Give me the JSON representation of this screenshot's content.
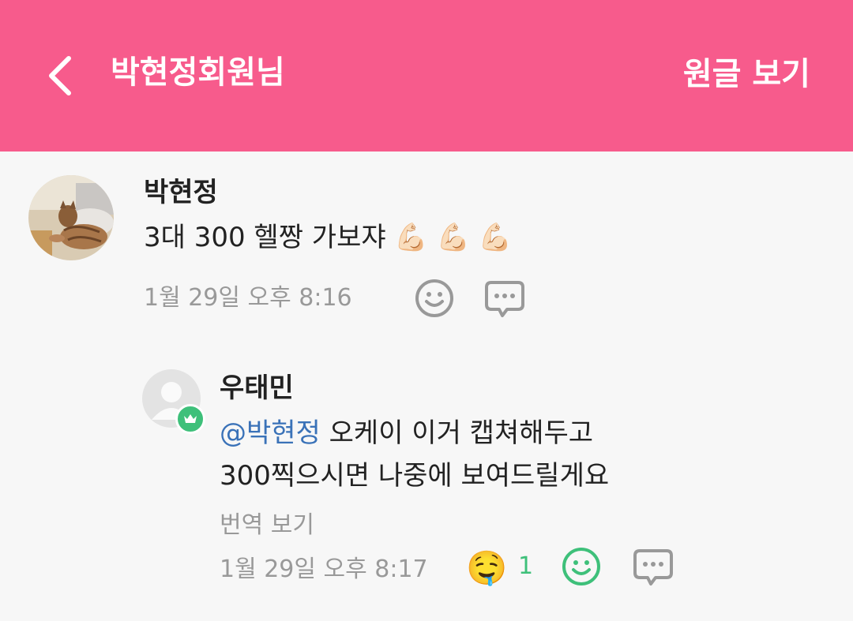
{
  "header": {
    "title": "박현정회원님",
    "action_label": "원글 보기",
    "background_color": "#f75b8c"
  },
  "comment": {
    "author": "박현정",
    "text": "3대 300 헬짱 가보쟈 💪🏻 💪🏻 💪🏻",
    "timestamp": "1월 29일 오후 8:16",
    "avatar_icon": "cat-photo-avatar",
    "reaction_icon": "smiley-icon",
    "reply_icon": "speech-bubble-icon"
  },
  "reply": {
    "author": "우태민",
    "mention": "@박현정",
    "text_line1": " 오케이 이거 캡쳐해두고",
    "text_line2": "300찍으시면 나중에 보여드릴게요",
    "translate_label": "번역 보기",
    "timestamp": "1월 29일 오후 8:17",
    "reaction_emoji": "🤤",
    "reaction_count": "1",
    "avatar_icon": "default-user-avatar",
    "badge_icon": "crown-icon",
    "accent_color": "#3ec07a",
    "mention_color": "#3a72b8"
  }
}
